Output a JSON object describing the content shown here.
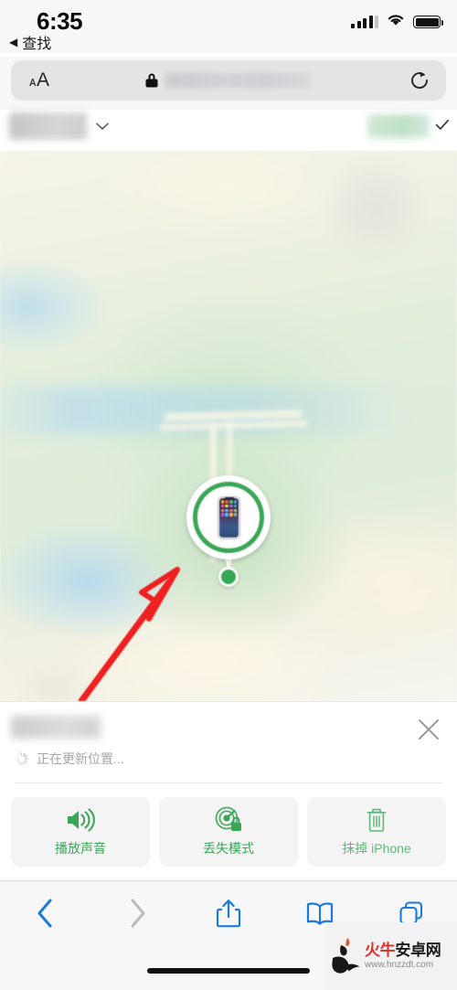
{
  "statusbar": {
    "time": "6:35",
    "cellular_icon": "signal-bars-icon",
    "wifi_icon": "wifi-icon",
    "battery_icon": "battery-full-icon"
  },
  "back_link": {
    "caret": "◀",
    "label": "查找"
  },
  "urlbar": {
    "text_size_label": "ᴀA",
    "lock_icon": "lock-icon",
    "url_value": "",
    "url_blurred": true,
    "reload_icon": "reload-icon"
  },
  "pageheader": {
    "device_selector_value": "",
    "device_selector_blurred": true,
    "chevron_icon": "chevron-down-icon",
    "status_chip_value": "",
    "status_chip_blurred": true,
    "check_icon": "check-icon"
  },
  "map": {
    "pin": {
      "device_icon": "iphone-icon",
      "ring_color": "#3aa656",
      "dot_color": "#34a853"
    },
    "annotation": {
      "type": "red-arrow",
      "color": "#ee2020"
    }
  },
  "sheet": {
    "device_name": "",
    "device_name_blurred": true,
    "close_icon": "close-icon",
    "status_text": "正在更新位置...",
    "spinner_icon": "spinner-icon",
    "actions": [
      {
        "label": "播放声音",
        "icon": "speaker-waves-icon",
        "color": "#3aa656"
      },
      {
        "label": "丢失模式",
        "icon": "radar-lock-icon",
        "color": "#3aa656"
      },
      {
        "label": "抹掉 iPhone",
        "icon": "trash-icon",
        "color": "#5fb879"
      }
    ]
  },
  "safari_toolbar": {
    "back_icon": "chevron-left-icon",
    "forward_icon": "chevron-right-icon",
    "share_icon": "share-icon",
    "bookmarks_icon": "book-icon",
    "tabs_icon": "tabs-icon",
    "accent_color": "#1a7ae0",
    "disabled_color": "#b9bbbd"
  },
  "watermark": {
    "main_red": "火牛",
    "main_black": "安卓网",
    "sub": "www.hnzzdt.com"
  }
}
